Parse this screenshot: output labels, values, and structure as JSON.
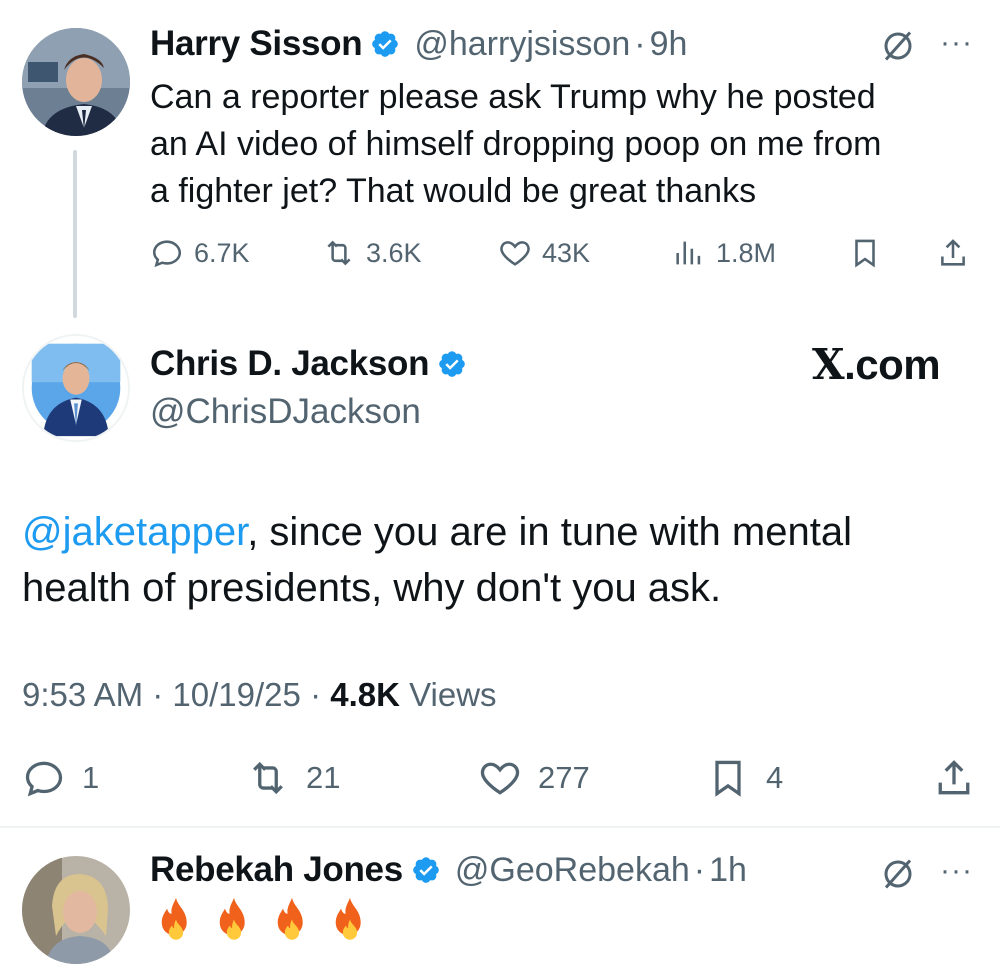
{
  "parent_tweet": {
    "display_name": "Harry Sisson",
    "handle": "@harryjsisson",
    "time": "9h",
    "text_lines": [
      "Can a reporter please ask Trump why he posted",
      "an AI video of himself dropping poop on me from",
      "a fighter jet? That would be great thanks"
    ],
    "replies": "6.7K",
    "reposts": "3.6K",
    "likes": "43K",
    "views": "1.8M"
  },
  "main_tweet": {
    "display_name": "Chris D. Jackson",
    "handle": "@ChrisDJackson",
    "watermark": ".com",
    "watermark_x": "X",
    "mention": "@jaketapper",
    "text_rest": ", since you are in tune with mental",
    "text_line2": "health of presidents, why don't you ask.",
    "time": "9:53 AM",
    "date": "10/19/25",
    "views_count": "4.8K",
    "views_label": "Views",
    "replies": "1",
    "reposts": "21",
    "likes": "277",
    "bookmarks": "4"
  },
  "reply_tweet": {
    "display_name": "Rebekah Jones",
    "handle": "@GeoRebekah",
    "time": "1h",
    "emoji_count": 4
  },
  "colors": {
    "accent": "#1d9bf0",
    "muted": "#536471",
    "text": "#0f1419"
  },
  "icons": [
    "verified-badge-icon",
    "grok-icon",
    "more-icon",
    "reply-icon",
    "repost-icon",
    "like-icon",
    "views-icon",
    "bookmark-icon",
    "share-icon",
    "fire-emoji-icon"
  ]
}
